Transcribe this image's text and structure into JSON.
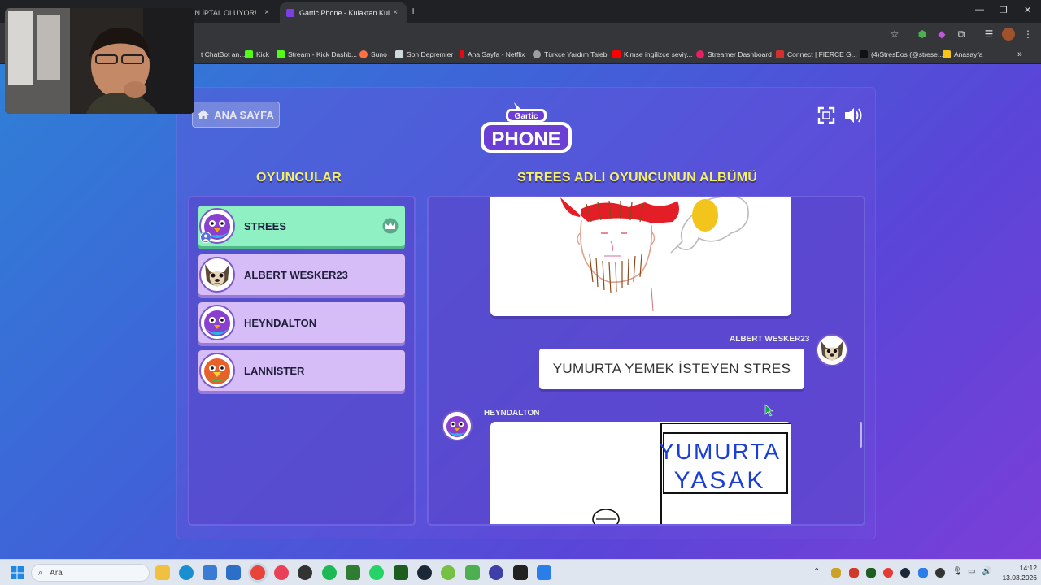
{
  "browser": {
    "tabs": [
      {
        "title": "... OYUN İPTAL OLUYOR!",
        "favicon_color": "#e53935"
      },
      {
        "title": "Gartic Phone - Kulaktan Kulağa",
        "favicon_color": "#7b3fe4"
      }
    ],
    "new_tab_symbol": "+",
    "close_symbol": "×",
    "window_controls": [
      "—",
      "❐",
      "✕"
    ],
    "bookmarks": [
      {
        "label": "t ChatBot an...",
        "color": "#4caf50"
      },
      {
        "label": "Kick",
        "color": "#53fc18"
      },
      {
        "label": "Stream - Kick Dashb...",
        "color": "#53fc18"
      },
      {
        "label": "Suno",
        "color": "#ff7043"
      },
      {
        "label": "Son Depremler",
        "color": "#cfd8dc"
      },
      {
        "label": "Ana Sayfa - Netflix",
        "color": "#e50914"
      },
      {
        "label": "Türkçe Yardım Talebi",
        "color": "#9e9e9e"
      },
      {
        "label": "Kimse ingilizce seviy...",
        "color": "#ff0000"
      },
      {
        "label": "Streamer Dashboard",
        "color": "#e91e63"
      },
      {
        "label": "Connect | FIERCE G...",
        "color": "#d32f2f"
      },
      {
        "label": "(4)StresEos (@strese...",
        "color": "#111111"
      },
      {
        "label": "Anasayfa",
        "color": "#f5c518"
      }
    ],
    "more_bookmarks": "»"
  },
  "game": {
    "home_button": "ANA SAYFA",
    "logo_top": "Gartic",
    "logo_bottom": "PHONE",
    "players_title": "OYUNCULAR",
    "album_title": "STREES ADLI OYUNCUNUN ALBÜMÜ",
    "players": [
      {
        "name": "STREES",
        "host": true
      },
      {
        "name": "ALBERT WESKER23",
        "host": false
      },
      {
        "name": "HEYNDALTON",
        "host": false
      },
      {
        "name": "LANNİSTER",
        "host": false
      }
    ],
    "album": {
      "guess_author": "ALBERT WESKER23",
      "guess_text": "YUMURTA YEMEK İSTEYEN STRES",
      "drawing_author": "HEYNDALTON",
      "drawing_text_line1": "YUMURTA",
      "drawing_text_line2": "YASAK"
    }
  },
  "taskbar": {
    "search_placeholder": "Ara",
    "time": "14:12",
    "date": "13.03.2026"
  },
  "colors": {
    "title_yellow": "#f3f06a",
    "player_card": "#d7bdf7",
    "host_card": "#8ef0c3"
  }
}
